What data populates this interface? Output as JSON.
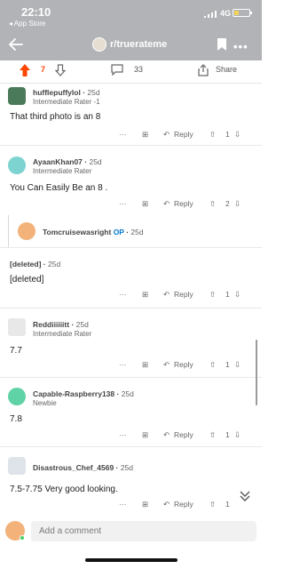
{
  "status": {
    "time": "22:10",
    "back_app": "◂ App Store",
    "network": "4G"
  },
  "nav": {
    "subreddit": "r/truerateme",
    "more": "•••"
  },
  "post": {
    "score": "7",
    "comments": "33",
    "share": "Share"
  },
  "actions": {
    "dots": "···",
    "reply": "Reply"
  },
  "comments": [
    {
      "user": "hufflepuffylol",
      "age": "25d",
      "flair": "Intermediate Rater -1",
      "body": "That third photo is an 8",
      "votes": "1"
    },
    {
      "user": "AyaanKhan07",
      "age": "25d",
      "flair": "Intermediate Rater",
      "body": "You Can Easily Be an 8 .",
      "votes": "2"
    },
    {
      "user": "Tomcruisewasright",
      "op": "OP",
      "age": "25d"
    },
    {
      "user": "[deleted]",
      "age": "25d",
      "body": "[deleted]",
      "votes": "1"
    },
    {
      "user": "Reddiiiiiitt",
      "age": "25d",
      "flair": "Intermediate Rater",
      "body": "7.7",
      "votes": "1"
    },
    {
      "user": "Capable-Raspberry138",
      "age": "25d",
      "flair": "Newbie",
      "body": "7.8",
      "votes": "1"
    },
    {
      "user": "Disastrous_Chef_4569",
      "age": "25d",
      "body": "7.5-7.75 Very good looking.",
      "votes": "1"
    }
  ],
  "composer": {
    "placeholder": "Add a comment"
  },
  "colors": {
    "header": "#b1b3b6",
    "upvote": "#ff4500",
    "op": "#0079d3",
    "online": "#46d160"
  }
}
